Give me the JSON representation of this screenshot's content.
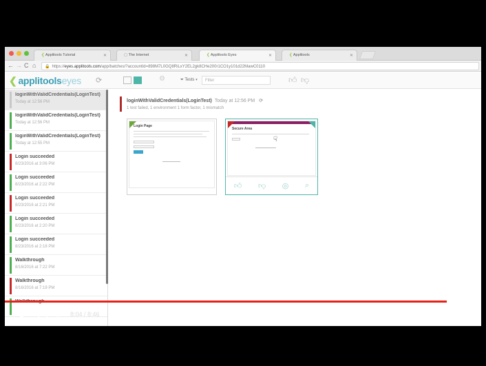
{
  "browser": {
    "tabs": [
      {
        "label": "Applitools Tutorial"
      },
      {
        "label": "The Internet"
      },
      {
        "label": "Applitools Eyes"
      },
      {
        "label": "Applitools"
      }
    ],
    "url_scheme": "https://",
    "url_host": "eyes.applitools.com",
    "url_rest": "/app/batches/?accountId=898M7L0GQ8RiLxY2EL2gk8CHe200r1CO1y101d22MawC0110"
  },
  "app": {
    "logo_bold": "applitools",
    "logo_light": "eyes",
    "tests_label": "Tests",
    "filter_placeholder": "Filter"
  },
  "sidebar": {
    "items": [
      {
        "title": "loginWithValidCredentials(LoginTest)",
        "date": "Today at 12:56 PM",
        "status": "selected",
        "color": "#c8c8c8"
      },
      {
        "title": "loginWithValidCredentials(LoginTest)",
        "date": "Today at 12:56 PM",
        "status": "passed",
        "color": "#4caf50"
      },
      {
        "title": "loginWithValidCredentials(LoginTest)",
        "date": "Today at 12:55 PM",
        "status": "passed",
        "color": "#4caf50"
      },
      {
        "title": "Login succeeded",
        "date": "8/23/2016 at 3:06 PM",
        "status": "failed",
        "color": "#c62828"
      },
      {
        "title": "Login succeeded",
        "date": "8/23/2016 at 2:22 PM",
        "status": "passed",
        "color": "#4caf50"
      },
      {
        "title": "Login succeeded",
        "date": "8/23/2016 at 2:21 PM",
        "status": "failed",
        "color": "#c62828"
      },
      {
        "title": "Login succeeded",
        "date": "8/23/2016 at 2:20 PM",
        "status": "passed",
        "color": "#4caf50"
      },
      {
        "title": "Login succeeded",
        "date": "8/23/2016 at 2:18 PM",
        "status": "passed",
        "color": "#4caf50"
      },
      {
        "title": "Walkthrough",
        "date": "8/16/2016 at 7:22 PM",
        "status": "passed",
        "color": "#4caf50"
      },
      {
        "title": "Walkthrough",
        "date": "8/16/2016 at 7:19 PM",
        "status": "failed",
        "color": "#c62828"
      },
      {
        "title": "Walkthrough",
        "date": "",
        "status": "passed",
        "color": "#4caf50"
      }
    ]
  },
  "main": {
    "test_name": "loginWithValidCredentials(LoginTest)",
    "test_time": "Today at 12:56 PM",
    "summary": "1 test failed,  1 environment  1 form factor,  1 mismatch",
    "step1_heading": "Login Page",
    "step2_heading": "Secure Area"
  },
  "video": {
    "current_time": "8:04",
    "duration": "8:46",
    "progress": 0.928
  },
  "colors": {
    "accent": "#3a9fb5",
    "progress": "#e62117",
    "fail": "#c62828",
    "pass": "#4caf50",
    "match_border": "#4db6a8"
  }
}
